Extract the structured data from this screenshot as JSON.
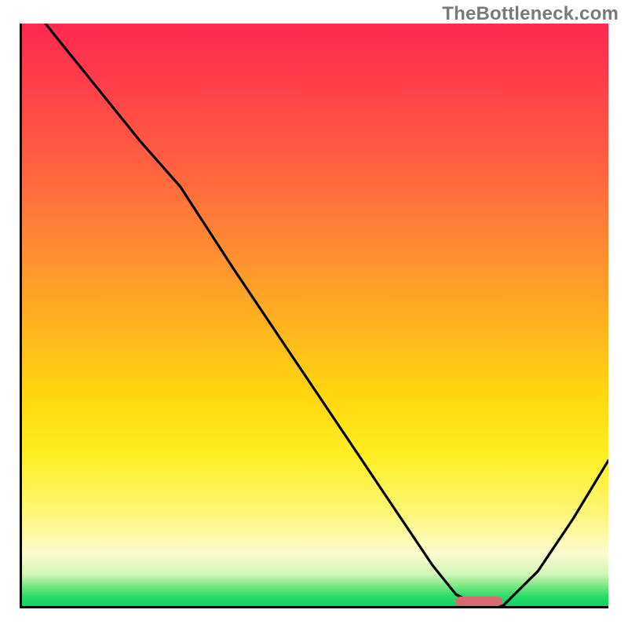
{
  "watermark": "TheBottleneck.com",
  "chart_data": {
    "type": "line",
    "title": "",
    "xlabel": "",
    "ylabel": "",
    "xlim": [
      0,
      100
    ],
    "ylim": [
      0,
      100
    ],
    "grid": false,
    "legend": false,
    "background": "red-yellow-green vertical heat gradient",
    "series": [
      {
        "name": "bottleneck-curve",
        "x": [
          4,
          12,
          20,
          27,
          36,
          46,
          56,
          64,
          70,
          74,
          78,
          82,
          88,
          94,
          100
        ],
        "y": [
          100,
          90,
          80,
          72,
          58,
          43,
          28,
          16,
          7,
          2,
          0,
          0,
          6,
          15,
          25
        ]
      }
    ],
    "marker": {
      "name": "optimal-range",
      "x_start": 74,
      "x_end": 82,
      "y": 0,
      "color": "#d76a6f"
    }
  },
  "plot": {
    "inner_width": 746,
    "inner_height": 741
  },
  "colors": {
    "axis": "#000000",
    "curve": "#000000",
    "marker": "#d76a6f",
    "watermark": "#7a7a7a"
  }
}
